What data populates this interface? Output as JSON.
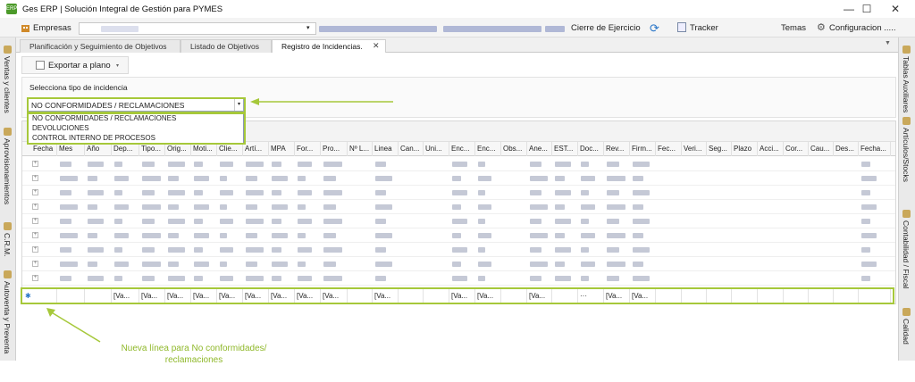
{
  "window": {
    "title": "Ges ERP | Solución Integral de Gestión para PYMES",
    "icon_text": "ERP",
    "minimize": "—",
    "maximize": "☐",
    "close": "✕"
  },
  "toolbar": {
    "empresas_label": "Empresas",
    "cierre_label": "Cierre de Ejercicio",
    "tracker_label": "Tracker",
    "temas_label": "Temas",
    "config_label": "Configuracion",
    "config_tail": ".....",
    "select_arrow": "▾"
  },
  "tabs": [
    {
      "label": "Planificación y Seguimiento de Objetivos"
    },
    {
      "label": "Listado de Objetivos"
    },
    {
      "label": "Registro de Incidencias."
    }
  ],
  "tab_close": "✕",
  "tab_menu": "▼",
  "left_sidebar": [
    "Ventas y clientes",
    "Aprovisionamientos",
    "C.R.M.",
    "Autoventa y Preventa"
  ],
  "right_sidebar": [
    "Tablas Auxiliares",
    "Artículos/Stocks",
    "Contabilidad / Fiscal",
    "Calidad"
  ],
  "subtoolbar": {
    "export_label": "Exportar a plano",
    "dropdown": "▾"
  },
  "filter": {
    "label": "Selecciona tipo de incidencia",
    "selected": "NO CONFORMIDADES / RECLAMACIONES",
    "arrow": "▾",
    "options": [
      "NO CONFORMIDADES / RECLAMACIONES",
      "DEVOLUCIONES",
      "CONTROL INTERNO DE PROCESOS"
    ]
  },
  "grid": {
    "columns": [
      "Fecha",
      "Mes",
      "Año",
      "Dep...",
      "Tipo...",
      "Orig...",
      "Moti...",
      "Clie...",
      "Artí...",
      "MPA",
      "For...",
      "Pro...",
      "Nº L...",
      "Linea",
      "Can...",
      "Uni...",
      "Enc...",
      "Enc...",
      "Obs...",
      "Ane...",
      "EST...",
      "Doc...",
      "Rev...",
      "Firm...",
      "Fec...",
      "Veri...",
      "Seg...",
      "Plazo",
      "Acci...",
      "Cor...",
      "Cau...",
      "Des...",
      "Fecha..."
    ],
    "expand_glyph": "+",
    "new_row_marker": "✱",
    "new_row": [
      "",
      "",
      "",
      "[Va...",
      "[Va...",
      "[Va...",
      "[Va...",
      "[Va...",
      "[Va...",
      "[Va...",
      "[Va...",
      "[Va...",
      "",
      "[Va...",
      "",
      "",
      "[Va...",
      "[Va...",
      "",
      "[Va...",
      "",
      "···",
      "[Va...",
      "[Va...",
      "",
      "",
      "",
      "",
      "",
      "",
      "",
      "",
      ""
    ]
  },
  "annotation": {
    "note": "Nueva línea para No conformidades/ reclamaciones",
    "accent": "#a6c83a"
  }
}
